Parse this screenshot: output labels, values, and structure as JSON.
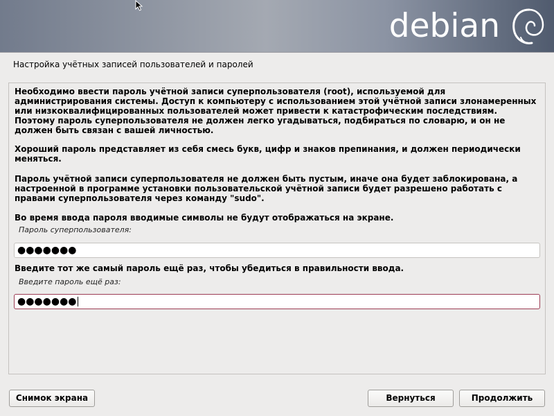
{
  "banner": {
    "logo_text": "debian",
    "logo_icon": "debian-swirl-icon"
  },
  "page": {
    "title": "Настройка учётных записей пользователей и паролей"
  },
  "content": {
    "paragraphs": [
      "Необходимо ввести пароль учётной записи суперпользователя (root), используемой для администрирования системы. Доступ к компьютеру с использованием этой учётной записи злонамеренных или низкоквалифицированных пользователей может привести к катастрофическим последствиям. Поэтому пароль суперпользователя не должен легко угадываться, подбираться по словарю, и он не должен быть связан с вашей личностью.",
      "Хороший пароль представляет из себя смесь букв, цифр и знаков препинания, и должен периодически меняться.",
      "Пароль учётной записи суперпользователя не должен быть пустым, иначе она будет заблокирована, а настроенной в программе установки пользовательской учётной записи будет разрешено работать с правами суперпользователя через команду \"sudo\".",
      "Во время ввода пароля вводимые символы не будут отображаться на экране."
    ],
    "password_label": "Пароль суперпользователя:",
    "password_value": "●●●●●●●",
    "confirm_prompt": "Введите тот же самый пароль ещё раз, чтобы убедиться в правильности ввода.",
    "confirm_label": "Введите пароль ещё раз:",
    "confirm_value": "●●●●●●●"
  },
  "buttons": {
    "screenshot": "Снимок экрана",
    "back": "Вернуться",
    "continue": "Продолжить"
  },
  "colors": {
    "focus_border": "#9c3c54",
    "background": "#edeceb"
  }
}
